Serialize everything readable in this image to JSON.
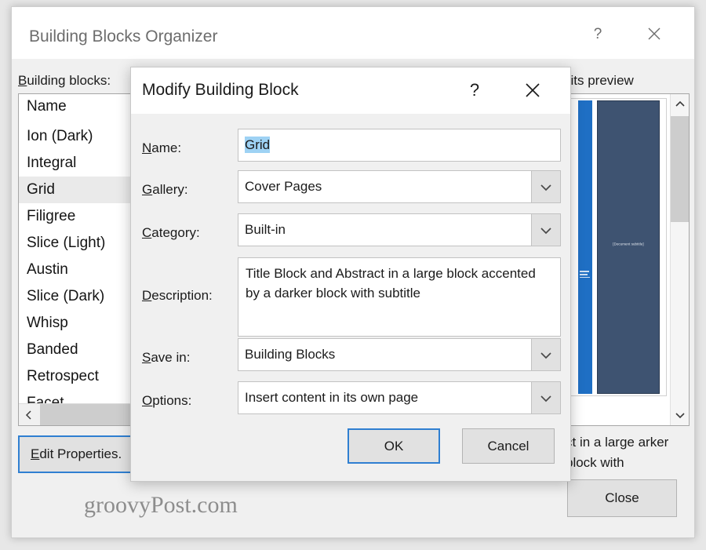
{
  "organizer": {
    "title": "Building Blocks Organizer",
    "help_icon": "question-mark-icon",
    "close_icon": "close-x-icon",
    "building_blocks_label": "Building blocks:",
    "preview_hint": "Click a building block to see its preview",
    "list": {
      "column_header": "Name",
      "items": [
        "Ion (Dark)",
        "Integral",
        "Grid",
        "Filigree",
        "Slice (Light)",
        "Austin",
        "Slice (Dark)",
        "Whisp",
        "Banded",
        "Retrospect",
        "Facet"
      ],
      "selected": "Grid"
    },
    "preview": {
      "subtitle_placeholder": "[Document subtitle]",
      "bracket_glyph": "]",
      "description": "ct in a large arker block with",
      "accent_blue": "#1f6fc4",
      "dark_block": "#3e5371"
    },
    "edit_properties_label": "Edit Properties.",
    "close_label": "Close",
    "watermark": "groovyPost.com"
  },
  "dialog": {
    "title": "Modify Building Block",
    "help_icon": "question-mark-icon",
    "close_icon": "close-x-icon",
    "fields": {
      "name_label": "Name:",
      "name_value": "Grid",
      "gallery_label": "Gallery:",
      "gallery_value": "Cover Pages",
      "category_label": "Category:",
      "category_value": "Built-in",
      "description_label": "Description:",
      "description_value": "Title Block and Abstract in a large block accented by a darker block with subtitle",
      "save_in_label": "Save in:",
      "save_in_value": "Building Blocks",
      "options_label": "Options:",
      "options_value": "Insert content in its own page"
    },
    "ok_label": "OK",
    "cancel_label": "Cancel",
    "dropdown_icon": "chevron-down-icon",
    "accent": "#2f7fd1"
  }
}
